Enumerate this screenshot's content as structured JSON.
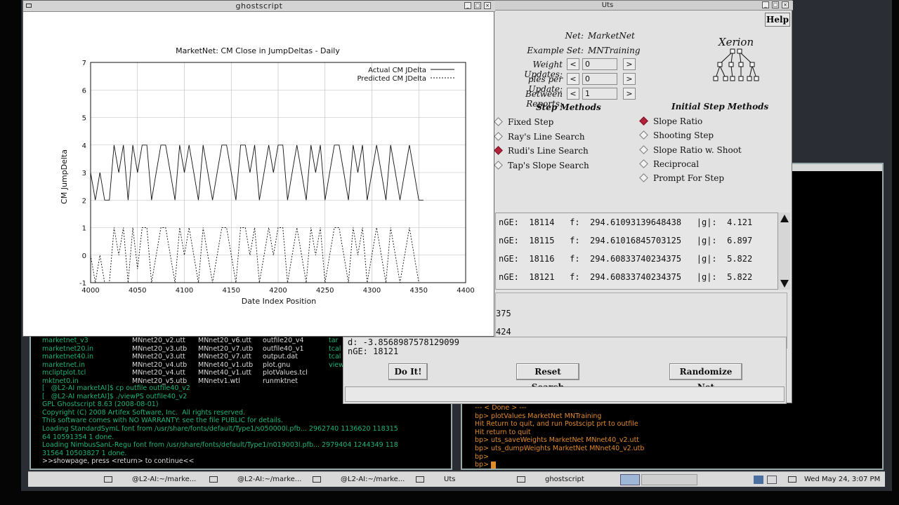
{
  "ghostscript": {
    "title": "ghostscript",
    "controls": {
      "minimize": "_",
      "maximize": "□",
      "close": "×"
    }
  },
  "chart_data": {
    "type": "line",
    "title": "MarketNet: CM Close in JumpDeltas - Daily",
    "xlabel": "Date Index Position",
    "ylabel": "CM JumpDelta",
    "xlim": [
      4000,
      4400
    ],
    "ylim": [
      -1,
      7
    ],
    "xticks": [
      "4000",
      "4050",
      "4100",
      "4150",
      "4200",
      "4250",
      "4300",
      "4350",
      "4400"
    ],
    "yticks": [
      "-1",
      "0",
      "1",
      "2",
      "3",
      "4",
      "5",
      "6",
      "7"
    ],
    "grid": true,
    "legend_position": "top-right",
    "series": [
      {
        "name": "Actual CM JDelta",
        "style": "solid",
        "x": [
          4000,
          4005,
          4010,
          4015,
          4020,
          4025,
          4030,
          4035,
          4040,
          4045,
          4050,
          4055,
          4060,
          4065,
          4070,
          4075,
          4080,
          4085,
          4090,
          4095,
          4100,
          4105,
          4110,
          4115,
          4120,
          4125,
          4130,
          4135,
          4140,
          4145,
          4150,
          4155,
          4160,
          4165,
          4170,
          4175,
          4180,
          4185,
          4190,
          4195,
          4200,
          4205,
          4210,
          4215,
          4220,
          4225,
          4230,
          4235,
          4240,
          4245,
          4250,
          4255,
          4260,
          4265,
          4270,
          4275,
          4280,
          4285,
          4290,
          4295,
          4300,
          4305,
          4310,
          4315,
          4320,
          4325,
          4330,
          4335,
          4340,
          4345,
          4350,
          4355
        ],
        "y": [
          3,
          2,
          3,
          2,
          2,
          4,
          3,
          4,
          2,
          4,
          3,
          4,
          4,
          2,
          3,
          4,
          4,
          3,
          2,
          4,
          3,
          4,
          3,
          2,
          4,
          3,
          2,
          3,
          4,
          4,
          3,
          2,
          4,
          4,
          3,
          4,
          2,
          3,
          4,
          3,
          4,
          4,
          2,
          3,
          4,
          3,
          2,
          4,
          3,
          4,
          2,
          3,
          4,
          4,
          3,
          2,
          4,
          3,
          4,
          2,
          3,
          4,
          3,
          2,
          4,
          3,
          2,
          3,
          4,
          3,
          2,
          2
        ]
      },
      {
        "name": "Predicted CM JDelta",
        "style": "dashed",
        "x": [
          4000,
          4005,
          4010,
          4015,
          4020,
          4025,
          4030,
          4035,
          4040,
          4045,
          4050,
          4055,
          4060,
          4065,
          4070,
          4075,
          4080,
          4085,
          4090,
          4095,
          4100,
          4105,
          4110,
          4115,
          4120,
          4125,
          4130,
          4135,
          4140,
          4145,
          4150,
          4155,
          4160,
          4165,
          4170,
          4175,
          4180,
          4185,
          4190,
          4195,
          4200,
          4205,
          4210,
          4215,
          4220,
          4225,
          4230,
          4235,
          4240,
          4245,
          4250,
          4255,
          4260,
          4265,
          4270,
          4275,
          4280,
          4285,
          4290,
          4295,
          4300,
          4305,
          4310,
          4315,
          4320,
          4325,
          4330,
          4335,
          4340,
          4345,
          4350,
          4355
        ],
        "y": [
          0,
          -1,
          0,
          -1,
          -1,
          1,
          0,
          1,
          -1,
          1,
          -0.5,
          1,
          1,
          -1,
          0,
          1,
          1,
          0,
          -1,
          1,
          0,
          1,
          0,
          -1,
          1,
          0,
          -1,
          0,
          1,
          1,
          0,
          -1,
          1,
          1,
          0,
          1,
          -1,
          0,
          1,
          0,
          1,
          1,
          -1,
          0,
          1,
          0,
          -1,
          1,
          0,
          1,
          -1,
          0,
          1,
          1,
          0,
          -1,
          1,
          0,
          1,
          -1,
          0,
          1,
          0,
          -1,
          1,
          0,
          -1,
          0,
          1,
          0,
          -1,
          -1
        ]
      }
    ]
  },
  "uts": {
    "title": "Uts",
    "help_label": "Help",
    "net_label": "Net:",
    "net_value": "MarketNet",
    "example_set_label": "Example Set:",
    "example_set_value": "MNTraining",
    "weight_updates_label": "Weight Updates:",
    "weight_updates_value": "0",
    "samples_per_update_label": "ples per Update:",
    "samples_per_update_value": "0",
    "between_reports_label": "Between Reports:",
    "between_reports_value": "1",
    "decrement": "<",
    "increment": ">",
    "logo": "Xerion",
    "step_methods_title": "Step Methods",
    "step_methods": [
      "Fixed Step",
      "Ray's Line Search",
      "Rudi's Line Search",
      "Tap's Slope Search"
    ],
    "step_methods_selected": 2,
    "initial_step_title": "Initial Step Methods",
    "initial_step_methods": [
      "Slope Ratio",
      "Shooting Step",
      "Slope Ratio w. Shoot",
      "Reciprocal",
      "Prompt For Step"
    ],
    "initial_step_selected": 0,
    "log_lines": [
      "nGE:  18114   f:  294.61093139648438   |g|:  4.121",
      "nGE:  18115   f:  294.61016845703125   |g|:  6.897",
      "nGE:  18116   f:  294.60833740234375   |g|:  5.822",
      "nGE:  18121   f:  294.60833740234375   |g|:  5.822"
    ],
    "status_lines": [
      "375",
      "424"
    ],
    "status_d": "d:  -3.8568987578129099",
    "status_nge": "nGE:  18121",
    "do_it_label": "Do It!",
    "reset_label": "Reset Search",
    "randomize_label": "Randomize Net"
  },
  "term_left": {
    "files": [
      [
        "marketnet_v3",
        "MNnet20_v2.utt",
        "MNnet20_v6.utt",
        "outfile20_v4",
        "tar"
      ],
      [
        "marketnet20.in",
        "MNnet20_v3.utb",
        "MNnet20_v7.utb",
        "outfile40_v1",
        "tcal"
      ],
      [
        "marketnet40.in",
        "MNnet20_v3.utt",
        "MNnet20_v7.utt",
        "output.dat",
        "tcal"
      ],
      [
        "marketnet.in",
        "MNnet20_v4.utb",
        "MNnet40_v1.utb",
        "plot.gnu",
        "view"
      ],
      [
        "mcliptplot.tcl",
        "MNnet20_v4.utt",
        "MNnet40_v1.utt",
        "plotValues.tcl",
        ""
      ],
      [
        "mktnet0.in",
        "MNnet20_v5.utb",
        "MNnetv1.wtl",
        "runmktnet",
        ""
      ]
    ],
    "lines": [
      "[   @L2-AI marketAI]$ cp outfile outfile40_v2",
      "[   @L2-AI marketAI]$ ./viewPS outfile40_v2",
      "GPL Ghostscript 8.63 (2008-08-01)",
      "Copyright (C) 2008 Artifex Software, Inc.  All rights reserved.",
      "This software comes with NO WARRANTY: see the file PUBLIC for details.",
      "Loading StandardSymL font from /usr/share/fonts/default/Type1/s050000l.pfb... 2962740 1136620 118315",
      "64 10591354 1 done.",
      "Loading NimbusSanL-Regu font from /usr/share/fonts/default/Type1/n019003l.pfb... 2979404 1244349 118",
      "31564 10503827 1 done.",
      ">>showpage, press <return> to continue<<"
    ]
  },
  "term_right": {
    "lines": [
      "--- < Done > ---",
      "bp> plotValues MarketNet MNTraining",
      "Hit Return to quit, and run Postscipt prt to outfile",
      "Hit return to quit",
      "bp> uts_saveWeights MarketNet MNnet40_v2.utt",
      "bp> uts_dumpWeights MarketNet MNnet40_v2.utb",
      "bp>",
      "bp> "
    ]
  },
  "taskbar": {
    "items": [
      "@L2-AI:~/marke...",
      "@L2-AI:~/marke...",
      "@L2-AI:~/marke...",
      "Uts",
      "ghostscript"
    ],
    "clock": "Wed May 24,  3:07 PM"
  },
  "colors": {
    "terminal_green": "#1fb37a",
    "terminal_orange": "#e08a2a",
    "radio_selected": "#b2223a"
  }
}
